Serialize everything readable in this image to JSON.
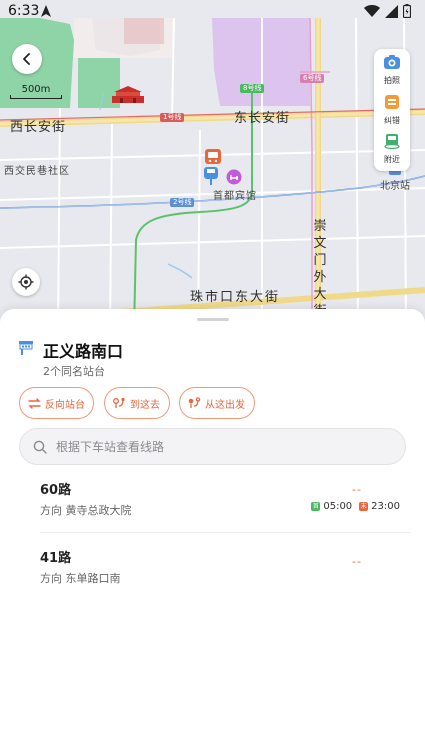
{
  "status_bar": {
    "time": "6:33"
  },
  "map": {
    "scale_label": "500m",
    "labels": {
      "street_west": "西长安街",
      "street_east": "东长安街",
      "community": "西交民巷社区",
      "poi_hotel": "首都宾馆",
      "station": "北京站",
      "street_south": "珠市口东大街",
      "street_vertical": "崇文门外大街"
    },
    "line_tags": {
      "line8": "8号线",
      "line6": "6号线",
      "line1": "1号线",
      "line2": "2号线"
    },
    "tools": [
      {
        "label": "拍照",
        "icon": "camera-icon"
      },
      {
        "label": "纠错",
        "icon": "correction-icon"
      },
      {
        "label": "附近",
        "icon": "nearby-bus-icon"
      }
    ],
    "colors": {
      "accent": "#e8663e",
      "park": "#7fcf9d",
      "district": "#dcc4ef",
      "line_green": "#5cc16c",
      "line_pink": "#e9a2c7"
    }
  },
  "sheet": {
    "stop_name": "正义路南口",
    "stop_sub": "2个同名站台",
    "actions": [
      {
        "label": "反向站台",
        "icon": "swap-icon"
      },
      {
        "label": "到这去",
        "icon": "route-to-icon"
      },
      {
        "label": "从这出发",
        "icon": "route-from-icon"
      }
    ],
    "search_placeholder": "根据下车站查看线路",
    "routes": [
      {
        "name": "60路",
        "direction": "方向 黄寺总政大院",
        "eta": "--",
        "first_badge": "首",
        "first": "05:00",
        "last_badge": "末",
        "last": "23:00"
      },
      {
        "name": "41路",
        "direction": "方向 东单路口南",
        "eta": "--"
      }
    ]
  }
}
